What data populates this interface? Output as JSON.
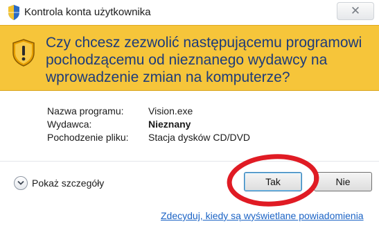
{
  "window": {
    "title": "Kontrola konta użytkownika",
    "close_symbol": "✕",
    "icon": "uac-shield-icon"
  },
  "banner": {
    "message": "Czy chcesz zezwolić następującemu programowi pochodzącemu od nieznanego wydawcy na wprowadzenie zmian na komputerze?",
    "icon": "warning-shield-icon",
    "color": "#f6c53a"
  },
  "details": {
    "program_name_label": "Nazwa programu:",
    "program_name_value": "Vision.exe",
    "publisher_label": "Wydawca:",
    "publisher_value": "Nieznany",
    "origin_label": "Pochodzenie pliku:",
    "origin_value": "Stacja dysków CD/DVD"
  },
  "actions": {
    "show_details_label": "Pokaż szczegóły",
    "yes_label": "Tak",
    "no_label": "Nie"
  },
  "footer": {
    "link_label": "Zdecyduj, kiedy są wyświetlane powiadomienia"
  },
  "highlight": {
    "color": "#e01b24"
  }
}
